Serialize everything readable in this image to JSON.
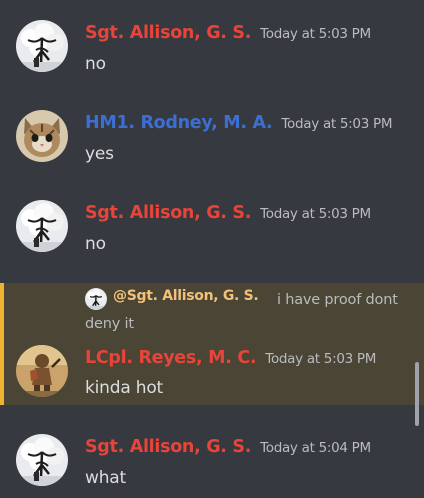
{
  "colors": {
    "background": "#36393f",
    "sergeant_name": "#e8443a",
    "corpsman_name": "#3b6fd4",
    "highlight_bg": "#4a4535",
    "highlight_bar": "#f0b232",
    "mention": "#f3c17a"
  },
  "messages": [
    {
      "author": "Sgt. Allison, G. S.",
      "time": "Today at 5:03 PM",
      "text": "no",
      "avatar": "snow-tree-avatar"
    },
    {
      "author": "HM1. Rodney, M. A.",
      "time": "Today at 5:03 PM",
      "text": "yes",
      "avatar": "kitten-avatar"
    },
    {
      "author": "Sgt. Allison, G. S.",
      "time": "Today at 5:03 PM",
      "text": "no",
      "avatar": "snow-tree-avatar"
    },
    {
      "author": "LCpl. Reyes, M. C.",
      "time": "Today at 5:03 PM",
      "text": "kinda hot",
      "avatar": "soldier-avatar",
      "reply": {
        "mention": "@Sgt. Allison, G. S.",
        "text": "i have proof dont deny it"
      }
    },
    {
      "author": "Sgt. Allison, G. S.",
      "time": "Today at 5:04 PM",
      "text": "what",
      "avatar": "snow-tree-avatar"
    }
  ]
}
